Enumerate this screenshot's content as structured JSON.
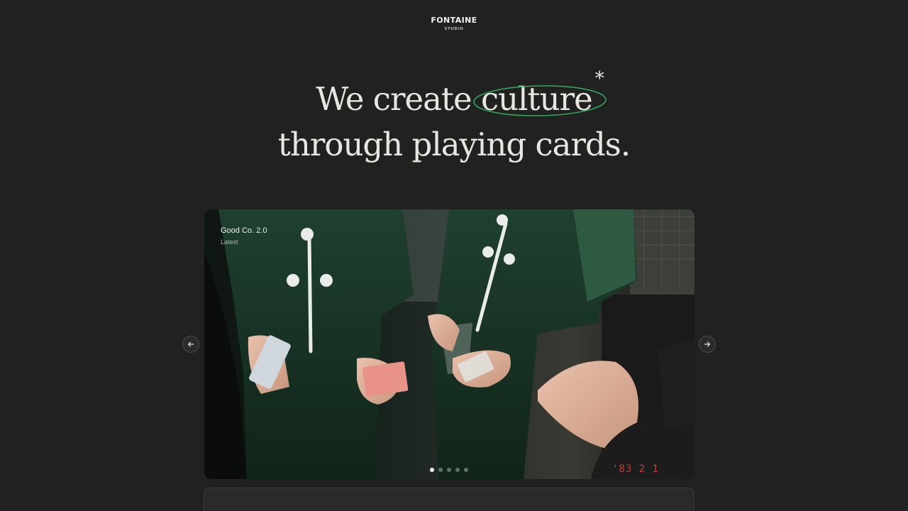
{
  "brand": {
    "name": "FONTAINE",
    "subtitle": "STUDIO"
  },
  "hero": {
    "line1_before": "We create",
    "line1_highlight": "culture",
    "asterisk": "*",
    "line2": "through playing cards."
  },
  "carousel": {
    "slide_title": "Good Co. 2.0",
    "slide_tag": "Latest",
    "film_stamp": "'83 2 1",
    "total_slides": 5,
    "active_slide": 1
  },
  "icons": {
    "prev": "arrow-left-icon",
    "next": "arrow-right-icon"
  },
  "colors": {
    "background": "#212121",
    "accent_ellipse": "#2fae5a",
    "shirt_green": "#1f3a2b"
  }
}
